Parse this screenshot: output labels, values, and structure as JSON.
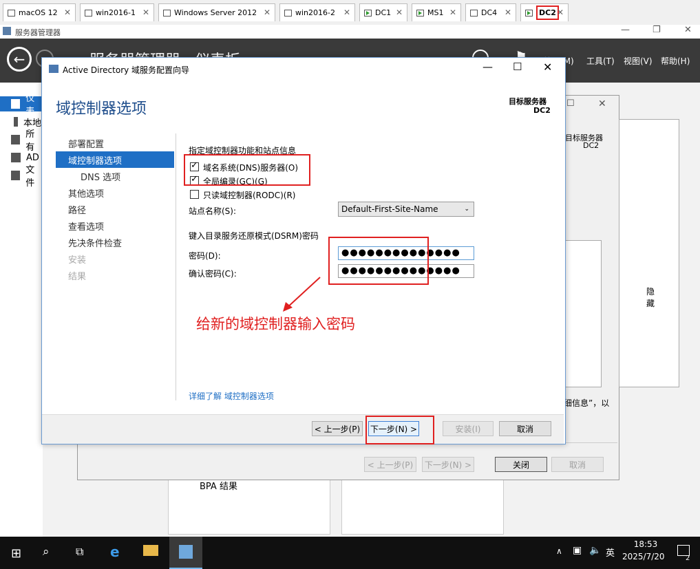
{
  "vm_tabs": [
    {
      "label": "macOS 12",
      "state": "off"
    },
    {
      "label": "win2016-1",
      "state": "off"
    },
    {
      "label": "Windows Server 2012",
      "state": "off"
    },
    {
      "label": "win2016-2",
      "state": "off"
    },
    {
      "label": "DC1",
      "state": "running"
    },
    {
      "label": "MS1",
      "state": "running"
    },
    {
      "label": "DC4",
      "state": "off"
    },
    {
      "label": "DC2",
      "state": "running",
      "active": true
    }
  ],
  "server_manager": {
    "window_title": "服务器管理器",
    "breadcrumb": "服务器管理器 · 仪表板",
    "menu": [
      "管理(M)",
      "工具(T)",
      "视图(V)",
      "帮助(H)"
    ],
    "sidebar": [
      "仪表",
      "本地",
      "所有",
      "AD",
      "文件"
    ],
    "bpa_label": "BPA 结果"
  },
  "background_wizard": {
    "target_label": "目标服务器",
    "target_value": "DC2",
    "hide_label": "隐藏",
    "info_text": "细信息”，以",
    "buttons": {
      "prev": "< 上一步(P)",
      "next": "下一步(N) >",
      "close": "关闭",
      "cancel": "取消"
    }
  },
  "dialog": {
    "title": "Active Directory 域服务配置向导",
    "heading": "域控制器选项",
    "target_label": "目标服务器",
    "target_value": "DC2",
    "nav": [
      {
        "label": "部署配置",
        "state": "normal"
      },
      {
        "label": "域控制器选项",
        "state": "selected"
      },
      {
        "label": "DNS 选项",
        "state": "sub"
      },
      {
        "label": "其他选项",
        "state": "normal"
      },
      {
        "label": "路径",
        "state": "normal"
      },
      {
        "label": "查看选项",
        "state": "normal"
      },
      {
        "label": "先决条件检查",
        "state": "normal"
      },
      {
        "label": "安装",
        "state": "disabled"
      },
      {
        "label": "结果",
        "state": "disabled"
      }
    ],
    "section1_title": "指定域控制器功能和站点信息",
    "checkboxes": [
      {
        "label": "域名系统(DNS)服务器(O)",
        "checked": true
      },
      {
        "label": "全局编录(GC)(G)",
        "checked": true
      },
      {
        "label": "只读域控制器(RODC)(R)",
        "checked": false
      }
    ],
    "site_label": "站点名称(S):",
    "site_value": "Default-First-Site-Name",
    "section2_title": "键入目录服务还原模式(DSRM)密码",
    "password_label": "密码(D):",
    "password_value": "●●●●●●●●●●●●●●",
    "confirm_label": "确认密码(C):",
    "confirm_value": "●●●●●●●●●●●●●●",
    "annotation": "给新的域控制器输入密码",
    "more_link": "详细了解 域控制器选项",
    "buttons": {
      "prev": "< 上一步(P)",
      "next": "下一步(N) >",
      "install": "安装(I)",
      "cancel": "取消"
    }
  },
  "taskbar": {
    "time": "18:53",
    "date": "2025/7/20",
    "ime": "英",
    "notification_count": "2"
  },
  "colors": {
    "accent": "#1f6fc5",
    "annotation": "#e02020",
    "header": "#3a3a3a"
  }
}
